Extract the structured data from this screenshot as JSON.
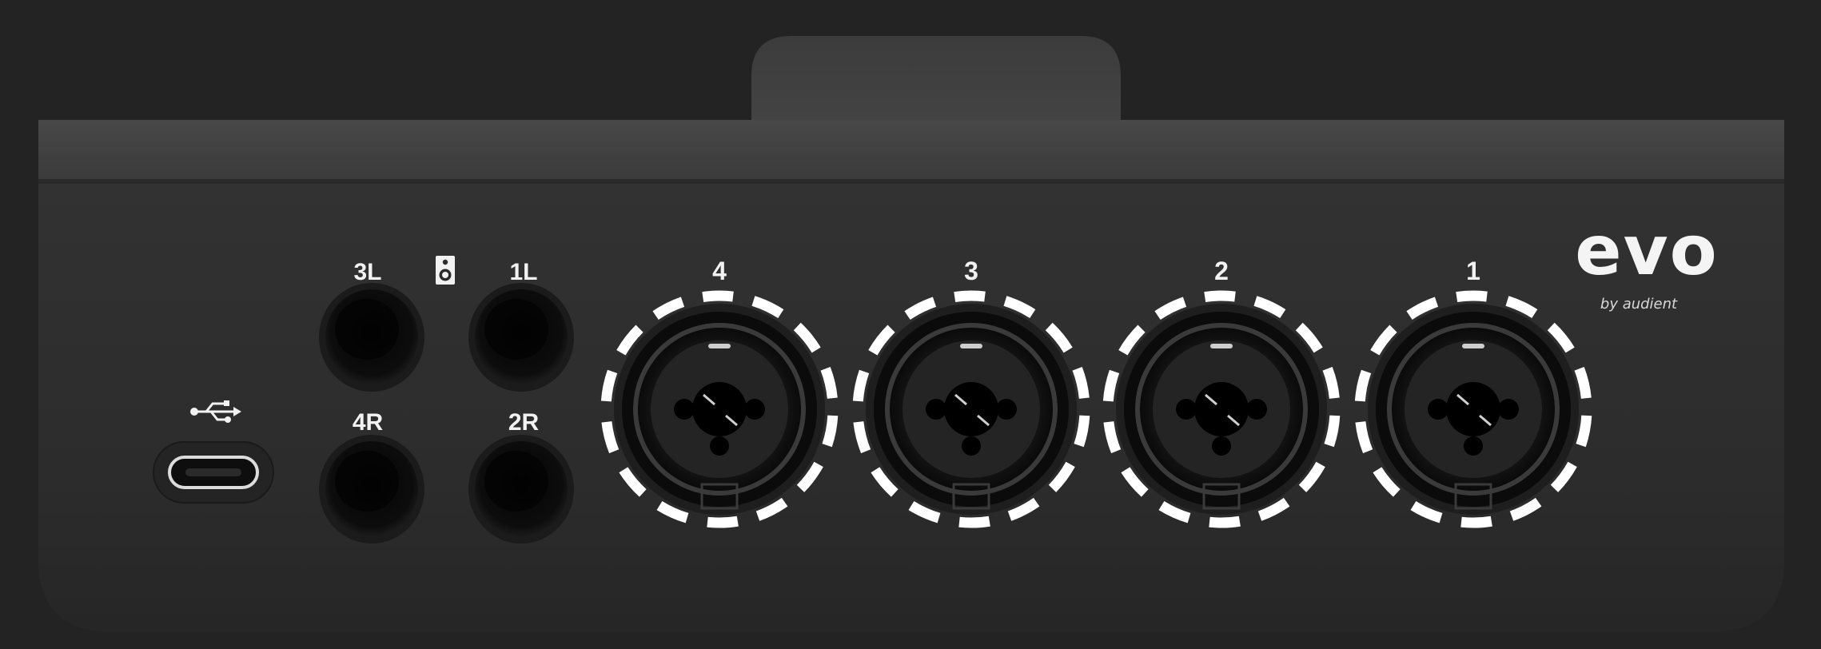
{
  "device": {
    "brand": "evo",
    "maker": "by audient"
  },
  "ports": {
    "usb": {
      "icon": "usb-icon",
      "type": "usb-c"
    },
    "speaker_icon": "speaker-icon",
    "line_outputs": [
      {
        "id": "3L",
        "label": "3L"
      },
      {
        "id": "1L",
        "label": "1L"
      },
      {
        "id": "4R",
        "label": "4R"
      },
      {
        "id": "2R",
        "label": "2R"
      }
    ],
    "combo_inputs": [
      {
        "id": "4",
        "label": "4",
        "highlighted": true
      },
      {
        "id": "3",
        "label": "3",
        "highlighted": true
      },
      {
        "id": "2",
        "label": "2",
        "highlighted": true
      },
      {
        "id": "1",
        "label": "1",
        "highlighted": true
      }
    ]
  },
  "colors": {
    "background": "#232323",
    "device_body": "#2f2f2f",
    "label_text": "#f2f2f2",
    "highlight_ring": "#ffffff"
  }
}
